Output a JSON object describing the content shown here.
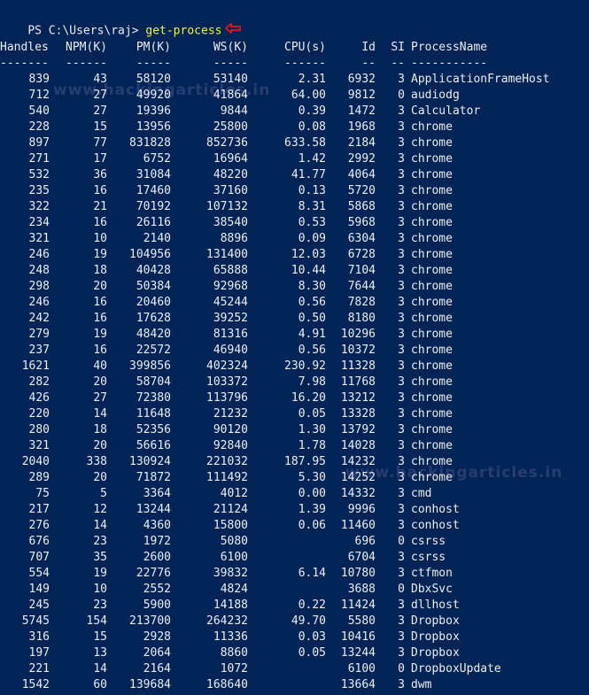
{
  "prompt": {
    "path": "PS C:\\Users\\raj> ",
    "command": "get-process"
  },
  "watermark": "www.hackingarticles.in",
  "headers": {
    "handles": "Handles",
    "npm": "NPM(K)",
    "pm": "PM(K)",
    "ws": "WS(K)",
    "cpu": "CPU(s)",
    "id": "Id",
    "si": "SI",
    "name": "ProcessName"
  },
  "underlines": {
    "handles": "-------",
    "npm": "------",
    "pm": "-----",
    "ws": "-----",
    "cpu": "------",
    "id": "--",
    "si": "--",
    "name": "-----------"
  },
  "rows": [
    {
      "handles": "839",
      "npm": "43",
      "pm": "58120",
      "ws": "53140",
      "cpu": "2.31",
      "id": "6932",
      "si": "3",
      "name": "ApplicationFrameHost"
    },
    {
      "handles": "712",
      "npm": "27",
      "pm": "49920",
      "ws": "41864",
      "cpu": "64.00",
      "id": "9812",
      "si": "0",
      "name": "audiodg"
    },
    {
      "handles": "540",
      "npm": "27",
      "pm": "19396",
      "ws": "9844",
      "cpu": "0.39",
      "id": "1472",
      "si": "3",
      "name": "Calculator"
    },
    {
      "handles": "228",
      "npm": "15",
      "pm": "13956",
      "ws": "25800",
      "cpu": "0.08",
      "id": "1968",
      "si": "3",
      "name": "chrome"
    },
    {
      "handles": "897",
      "npm": "77",
      "pm": "831828",
      "ws": "852736",
      "cpu": "633.58",
      "id": "2184",
      "si": "3",
      "name": "chrome"
    },
    {
      "handles": "271",
      "npm": "17",
      "pm": "6752",
      "ws": "16964",
      "cpu": "1.42",
      "id": "2992",
      "si": "3",
      "name": "chrome"
    },
    {
      "handles": "532",
      "npm": "36",
      "pm": "31084",
      "ws": "48220",
      "cpu": "41.77",
      "id": "4064",
      "si": "3",
      "name": "chrome"
    },
    {
      "handles": "235",
      "npm": "16",
      "pm": "17460",
      "ws": "37160",
      "cpu": "0.13",
      "id": "5720",
      "si": "3",
      "name": "chrome"
    },
    {
      "handles": "322",
      "npm": "21",
      "pm": "70192",
      "ws": "107132",
      "cpu": "8.31",
      "id": "5868",
      "si": "3",
      "name": "chrome"
    },
    {
      "handles": "234",
      "npm": "16",
      "pm": "26116",
      "ws": "38540",
      "cpu": "0.53",
      "id": "5968",
      "si": "3",
      "name": "chrome"
    },
    {
      "handles": "321",
      "npm": "10",
      "pm": "2140",
      "ws": "8896",
      "cpu": "0.09",
      "id": "6304",
      "si": "3",
      "name": "chrome"
    },
    {
      "handles": "246",
      "npm": "19",
      "pm": "104956",
      "ws": "131400",
      "cpu": "12.03",
      "id": "6728",
      "si": "3",
      "name": "chrome"
    },
    {
      "handles": "248",
      "npm": "18",
      "pm": "40428",
      "ws": "65888",
      "cpu": "10.44",
      "id": "7104",
      "si": "3",
      "name": "chrome"
    },
    {
      "handles": "298",
      "npm": "20",
      "pm": "50384",
      "ws": "92968",
      "cpu": "8.30",
      "id": "7644",
      "si": "3",
      "name": "chrome"
    },
    {
      "handles": "246",
      "npm": "16",
      "pm": "20460",
      "ws": "45244",
      "cpu": "0.56",
      "id": "7828",
      "si": "3",
      "name": "chrome"
    },
    {
      "handles": "242",
      "npm": "16",
      "pm": "17628",
      "ws": "39252",
      "cpu": "0.50",
      "id": "8180",
      "si": "3",
      "name": "chrome"
    },
    {
      "handles": "279",
      "npm": "19",
      "pm": "48420",
      "ws": "81316",
      "cpu": "4.91",
      "id": "10296",
      "si": "3",
      "name": "chrome"
    },
    {
      "handles": "237",
      "npm": "16",
      "pm": "22572",
      "ws": "46940",
      "cpu": "0.56",
      "id": "10372",
      "si": "3",
      "name": "chrome"
    },
    {
      "handles": "1621",
      "npm": "40",
      "pm": "399856",
      "ws": "402324",
      "cpu": "230.92",
      "id": "11328",
      "si": "3",
      "name": "chrome"
    },
    {
      "handles": "282",
      "npm": "20",
      "pm": "58704",
      "ws": "103372",
      "cpu": "7.98",
      "id": "11768",
      "si": "3",
      "name": "chrome"
    },
    {
      "handles": "426",
      "npm": "27",
      "pm": "72380",
      "ws": "113796",
      "cpu": "16.20",
      "id": "13212",
      "si": "3",
      "name": "chrome"
    },
    {
      "handles": "220",
      "npm": "14",
      "pm": "11648",
      "ws": "21232",
      "cpu": "0.05",
      "id": "13328",
      "si": "3",
      "name": "chrome"
    },
    {
      "handles": "280",
      "npm": "18",
      "pm": "52356",
      "ws": "90120",
      "cpu": "1.30",
      "id": "13792",
      "si": "3",
      "name": "chrome"
    },
    {
      "handles": "321",
      "npm": "20",
      "pm": "56616",
      "ws": "92840",
      "cpu": "1.78",
      "id": "14028",
      "si": "3",
      "name": "chrome"
    },
    {
      "handles": "2040",
      "npm": "338",
      "pm": "130924",
      "ws": "221032",
      "cpu": "187.95",
      "id": "14232",
      "si": "3",
      "name": "chrome"
    },
    {
      "handles": "289",
      "npm": "20",
      "pm": "71872",
      "ws": "111492",
      "cpu": "5.30",
      "id": "14252",
      "si": "3",
      "name": "chrome"
    },
    {
      "handles": "75",
      "npm": "5",
      "pm": "3364",
      "ws": "4012",
      "cpu": "0.00",
      "id": "14332",
      "si": "3",
      "name": "cmd"
    },
    {
      "handles": "217",
      "npm": "12",
      "pm": "13244",
      "ws": "21124",
      "cpu": "1.39",
      "id": "9996",
      "si": "3",
      "name": "conhost"
    },
    {
      "handles": "276",
      "npm": "14",
      "pm": "4360",
      "ws": "15800",
      "cpu": "0.06",
      "id": "11460",
      "si": "3",
      "name": "conhost"
    },
    {
      "handles": "676",
      "npm": "23",
      "pm": "1972",
      "ws": "5080",
      "cpu": "",
      "id": "696",
      "si": "0",
      "name": "csrss"
    },
    {
      "handles": "707",
      "npm": "35",
      "pm": "2600",
      "ws": "6100",
      "cpu": "",
      "id": "6704",
      "si": "3",
      "name": "csrss"
    },
    {
      "handles": "554",
      "npm": "19",
      "pm": "22776",
      "ws": "39832",
      "cpu": "6.14",
      "id": "10780",
      "si": "3",
      "name": "ctfmon"
    },
    {
      "handles": "149",
      "npm": "10",
      "pm": "2552",
      "ws": "4824",
      "cpu": "",
      "id": "3688",
      "si": "0",
      "name": "DbxSvc"
    },
    {
      "handles": "245",
      "npm": "23",
      "pm": "5900",
      "ws": "14188",
      "cpu": "0.22",
      "id": "11424",
      "si": "3",
      "name": "dllhost"
    },
    {
      "handles": "5745",
      "npm": "154",
      "pm": "213700",
      "ws": "264232",
      "cpu": "49.70",
      "id": "5580",
      "si": "3",
      "name": "Dropbox"
    },
    {
      "handles": "316",
      "npm": "15",
      "pm": "2928",
      "ws": "11336",
      "cpu": "0.03",
      "id": "10416",
      "si": "3",
      "name": "Dropbox"
    },
    {
      "handles": "197",
      "npm": "13",
      "pm": "2064",
      "ws": "8860",
      "cpu": "0.05",
      "id": "13244",
      "si": "3",
      "name": "Dropbox"
    },
    {
      "handles": "221",
      "npm": "14",
      "pm": "2164",
      "ws": "1072",
      "cpu": "",
      "id": "6100",
      "si": "0",
      "name": "DropboxUpdate"
    },
    {
      "handles": "1542",
      "npm": "60",
      "pm": "139684",
      "ws": "168640",
      "cpu": "",
      "id": "13664",
      "si": "3",
      "name": "dwm"
    }
  ]
}
